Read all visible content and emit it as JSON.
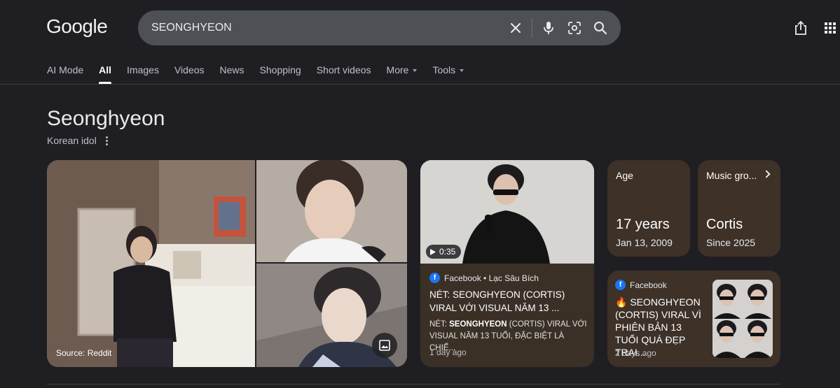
{
  "logo": "Google",
  "search": {
    "query": "SEONGHYEON"
  },
  "tabs": [
    {
      "label": "AI Mode"
    },
    {
      "label": "All"
    },
    {
      "label": "Images"
    },
    {
      "label": "Videos"
    },
    {
      "label": "News"
    },
    {
      "label": "Shopping"
    },
    {
      "label": "Short videos"
    },
    {
      "label": "More"
    },
    {
      "label": "Tools"
    }
  ],
  "entity": {
    "title": "Seonghyeon",
    "subtitle": "Korean idol"
  },
  "images": {
    "source_label": "Source: Reddit"
  },
  "video": {
    "duration": "0:35",
    "source": "Facebook • Lạc Sâu Bích",
    "title": "NÉT: SEONGHYEON (CORTIS) VIRAL VỚI VISUAL NĂM 13 ...",
    "snippet_prefix": "NÉT: ",
    "snippet_bold": "SEONGHYEON",
    "snippet_rest": " (CORTIS) VIRAL VỚI VISUAL NĂM 13 TUỔI, ĐẶC BIỆT LÀ CHIẾ...",
    "date": "1 day ago"
  },
  "facts": {
    "age": {
      "label": "Age",
      "value": "17 years",
      "sub": "Jan 13, 2009"
    },
    "group": {
      "label": "Music gro...",
      "value": "Cortis",
      "sub": "Since 2025"
    }
  },
  "post": {
    "source": "Facebook",
    "title": "🔥 SEONGHYEON (CORTIS) VIRAL VÌ PHIÊN BẢN 13 TUỔI QUÁ ĐẸP TRAI...",
    "date": "2 days ago"
  },
  "icons": {
    "clear": "close-icon",
    "voice": "mic-icon",
    "lens": "camera-icon",
    "search": "search-icon",
    "share": "share-icon",
    "apps": "apps-grid-icon"
  }
}
